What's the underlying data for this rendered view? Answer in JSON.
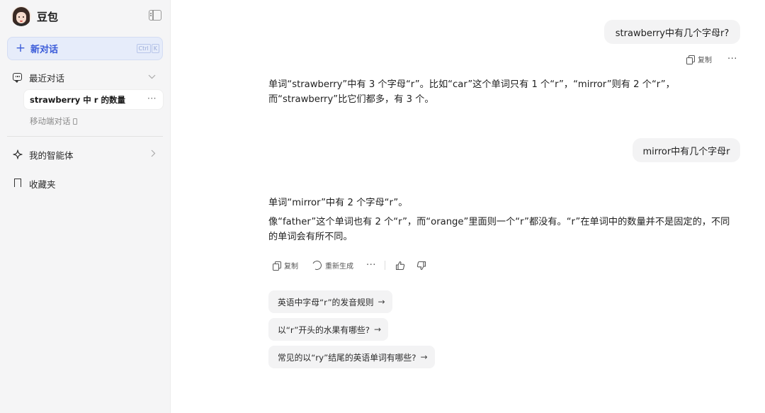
{
  "sidebar": {
    "brand": "豆包",
    "new_chat": {
      "label": "新对话",
      "shortcut": [
        "Ctrl",
        "K"
      ]
    },
    "recent_label": "最近对话",
    "conversations": [
      {
        "title": "strawberry 中 r 的数量"
      }
    ],
    "mobile_label": "移动端对话",
    "agents_label": "我的智能体",
    "favorites_label": "收藏夹"
  },
  "chat": {
    "messages": [
      {
        "role": "user",
        "text": "strawberry中有几个字母r?"
      },
      {
        "role": "assistant",
        "paragraphs": [
          "单词“strawberry”中有 3 个字母“r”。比如“car”这个单词只有 1 个“r”，“mirror”则有 2 个“r”，而“strawberry”比它们都多，有 3 个。"
        ]
      },
      {
        "role": "user",
        "text": "mirror中有几个字母r"
      },
      {
        "role": "assistant",
        "paragraphs": [
          "单词“mirror”中有 2 个字母“r”。",
          "像“father”这个单词也有 2 个“r”，而“orange”里面则一个“r”都没有。“r”在单词中的数量并不是固定的，不同的单词会有所不同。"
        ]
      }
    ],
    "actions": {
      "copy": "复制",
      "regenerate": "重新生成"
    },
    "suggestions": [
      "英语中字母“r”的发音规则",
      "以“r”开头的水果有哪些?",
      "常见的以“ry”结尾的英语单词有哪些?"
    ]
  }
}
